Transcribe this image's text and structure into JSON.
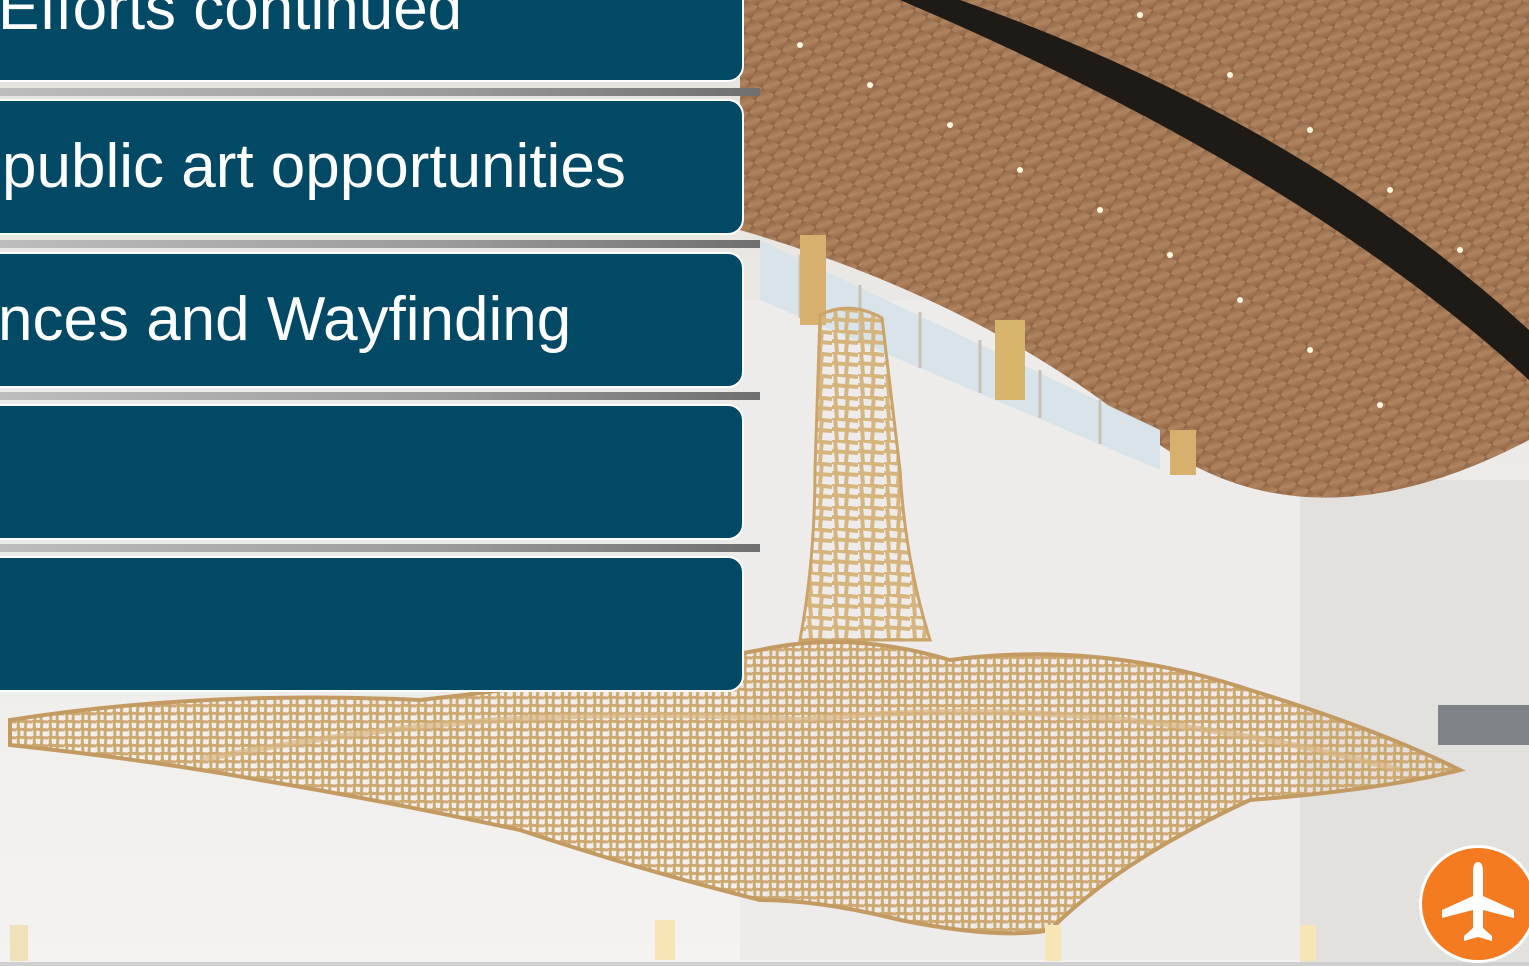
{
  "slide": {
    "panels": [
      {
        "text": "Efforts continued"
      },
      {
        "text": "public art opportunities"
      },
      {
        "text": "nces and Wayfinding"
      },
      {
        "text": ""
      },
      {
        "text": ""
      }
    ]
  },
  "colors": {
    "panel": "#024966",
    "logo": "#f47b20",
    "ceiling": "#a77a55",
    "sculpture": "#d8b783"
  },
  "icons": {
    "logo": "airplane-icon"
  }
}
